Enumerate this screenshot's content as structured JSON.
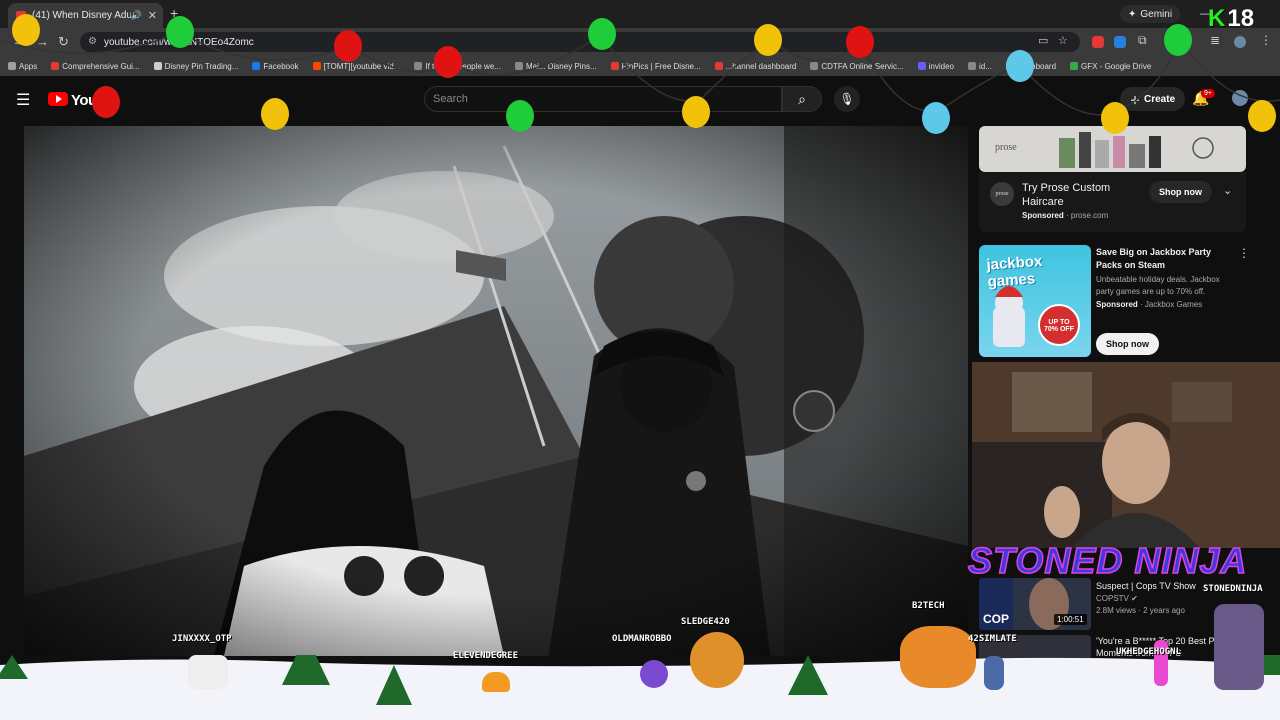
{
  "browser": {
    "tab_title": "(41) When Disney Adults R...",
    "new_tab": "+",
    "url": "youtube.com/w...=kNTQEo4Zomc",
    "gemini_label": "Gemini",
    "bookmarks": [
      {
        "label": "Apps",
        "color": "#9aa0a6"
      },
      {
        "label": "Comprehensive Gui...",
        "color": "#e53935"
      },
      {
        "label": "Disney Pin Trading...",
        "color": "#cccccc"
      },
      {
        "label": "Facebook",
        "color": "#1877f2"
      },
      {
        "label": "[TOMT][youtube vid...",
        "color": "#ff4500"
      },
      {
        "label": "If todays people we...",
        "color": "#888888"
      },
      {
        "label": "Mai... Disney Pins...",
        "color": "#888888"
      },
      {
        "label": "PinPics | Free Disne...",
        "color": "#e53935"
      },
      {
        "label": "...hannel dashboard",
        "color": "#e53935"
      },
      {
        "label": "CDTFA Online Servic...",
        "color": "#888888"
      },
      {
        "label": "invideo",
        "color": "#6b5cff"
      },
      {
        "label": "id...",
        "color": "#888888"
      },
      {
        "label": "Dashboard",
        "color": "#cccccc"
      },
      {
        "label": "GFX - Google Drive",
        "color": "#34a853"
      }
    ]
  },
  "youtube": {
    "logo_text": "YouT",
    "search_placeholder": "Search",
    "create_label": "Create",
    "notif_badge": "9+"
  },
  "ads": {
    "banner_brand": "prose",
    "ad1": {
      "title": "Try Prose Custom Haircare",
      "sponsored": "Sponsored",
      "domain": "prose.com",
      "cta": "Shop now",
      "logo": "prose"
    },
    "ad2": {
      "title": "Save Big on Jackbox Party Packs on Steam",
      "desc": "Unbeatable holiday deals. Jackbox party games are up to 70% off.",
      "sponsored": "Sponsored",
      "advertiser": "Jackbox Games",
      "cta": "Shop now",
      "thumb_text": "jackbox games",
      "badge": "UP TO 70% OFF"
    }
  },
  "recommendations": [
    {
      "title": "Suspect | Cops TV Show",
      "channel": "COPSTV",
      "meta": "2.8M views · 2 years ago",
      "duration": "1:00:51",
      "thumb_text": "COP"
    },
    {
      "title": "'You're a B***** Top 20 Best Police Moments from COPS"
    }
  ],
  "stream": {
    "overlay_title": "STONED NINJA",
    "streamer_tag": "STONEDNINJA",
    "k_logo": "K",
    "age": "18",
    "chatters": [
      "JINXXXX_OTP",
      "ELEVENDEGREE",
      "OLDMANROBBO",
      "SLEDGE420",
      "B2TECH",
      "42SIMLATE",
      "UKHEDGEHOGNL"
    ]
  },
  "colors": {
    "accent": "#ff0000",
    "ninja_fill": "#3c3cdc",
    "ninja_stroke": "#e040e0",
    "k_logo": "#22ee22"
  }
}
